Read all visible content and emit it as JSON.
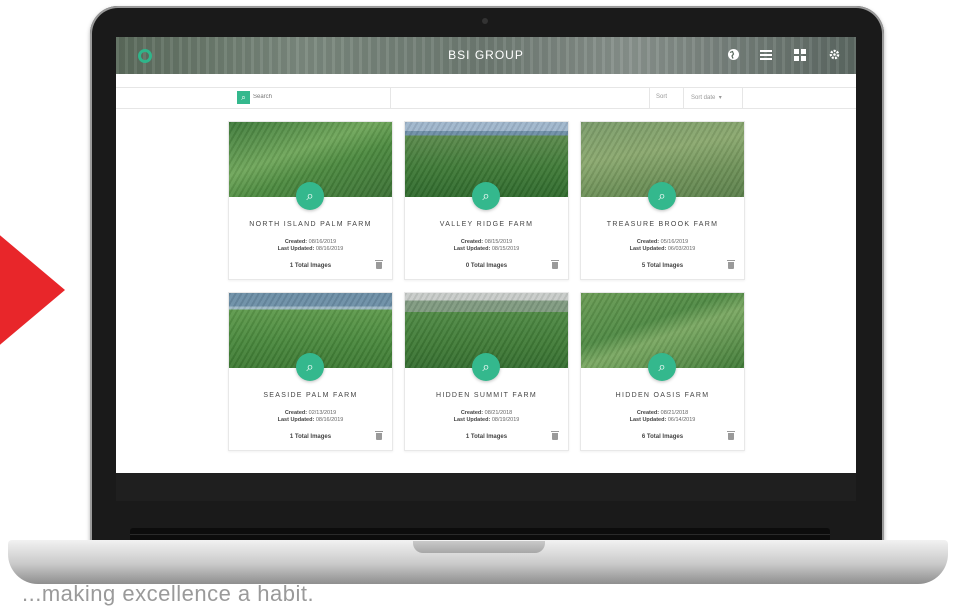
{
  "app": {
    "title": "BSI GROUP"
  },
  "toolbar": {
    "search_placeholder": "Search",
    "sort_label": "Sort",
    "sort_value": "Sort date"
  },
  "cards": [
    {
      "title": "NORTH ISLAND PALM FARM",
      "created_label": "Created:",
      "created": "08/16/2019",
      "updated_label": "Last Updated:",
      "updated": "08/16/2019",
      "total_images": "1 Total Images"
    },
    {
      "title": "VALLEY RIDGE FARM",
      "created_label": "Created:",
      "created": "08/15/2019",
      "updated_label": "Last Updated:",
      "updated": "08/15/2019",
      "total_images": "0 Total Images"
    },
    {
      "title": "TREASURE BROOK FARM",
      "created_label": "Created:",
      "created": "05/16/2019",
      "updated_label": "Last Updated:",
      "updated": "06/03/2019",
      "total_images": "5 Total Images"
    },
    {
      "title": "SEASIDE PALM FARM",
      "created_label": "Created:",
      "created": "02/13/2019",
      "updated_label": "Last Updated:",
      "updated": "08/16/2019",
      "total_images": "1 Total Images"
    },
    {
      "title": "HIDDEN SUMMIT FARM",
      "created_label": "Created:",
      "created": "08/21/2018",
      "updated_label": "Last Updated:",
      "updated": "08/19/2019",
      "total_images": "1 Total Images"
    },
    {
      "title": "HIDDEN OASIS FARM",
      "created_label": "Created:",
      "created": "08/21/2018",
      "updated_label": "Last Updated:",
      "updated": "06/14/2019",
      "total_images": "6 Total Images"
    }
  ],
  "tagline": "...making excellence a habit."
}
